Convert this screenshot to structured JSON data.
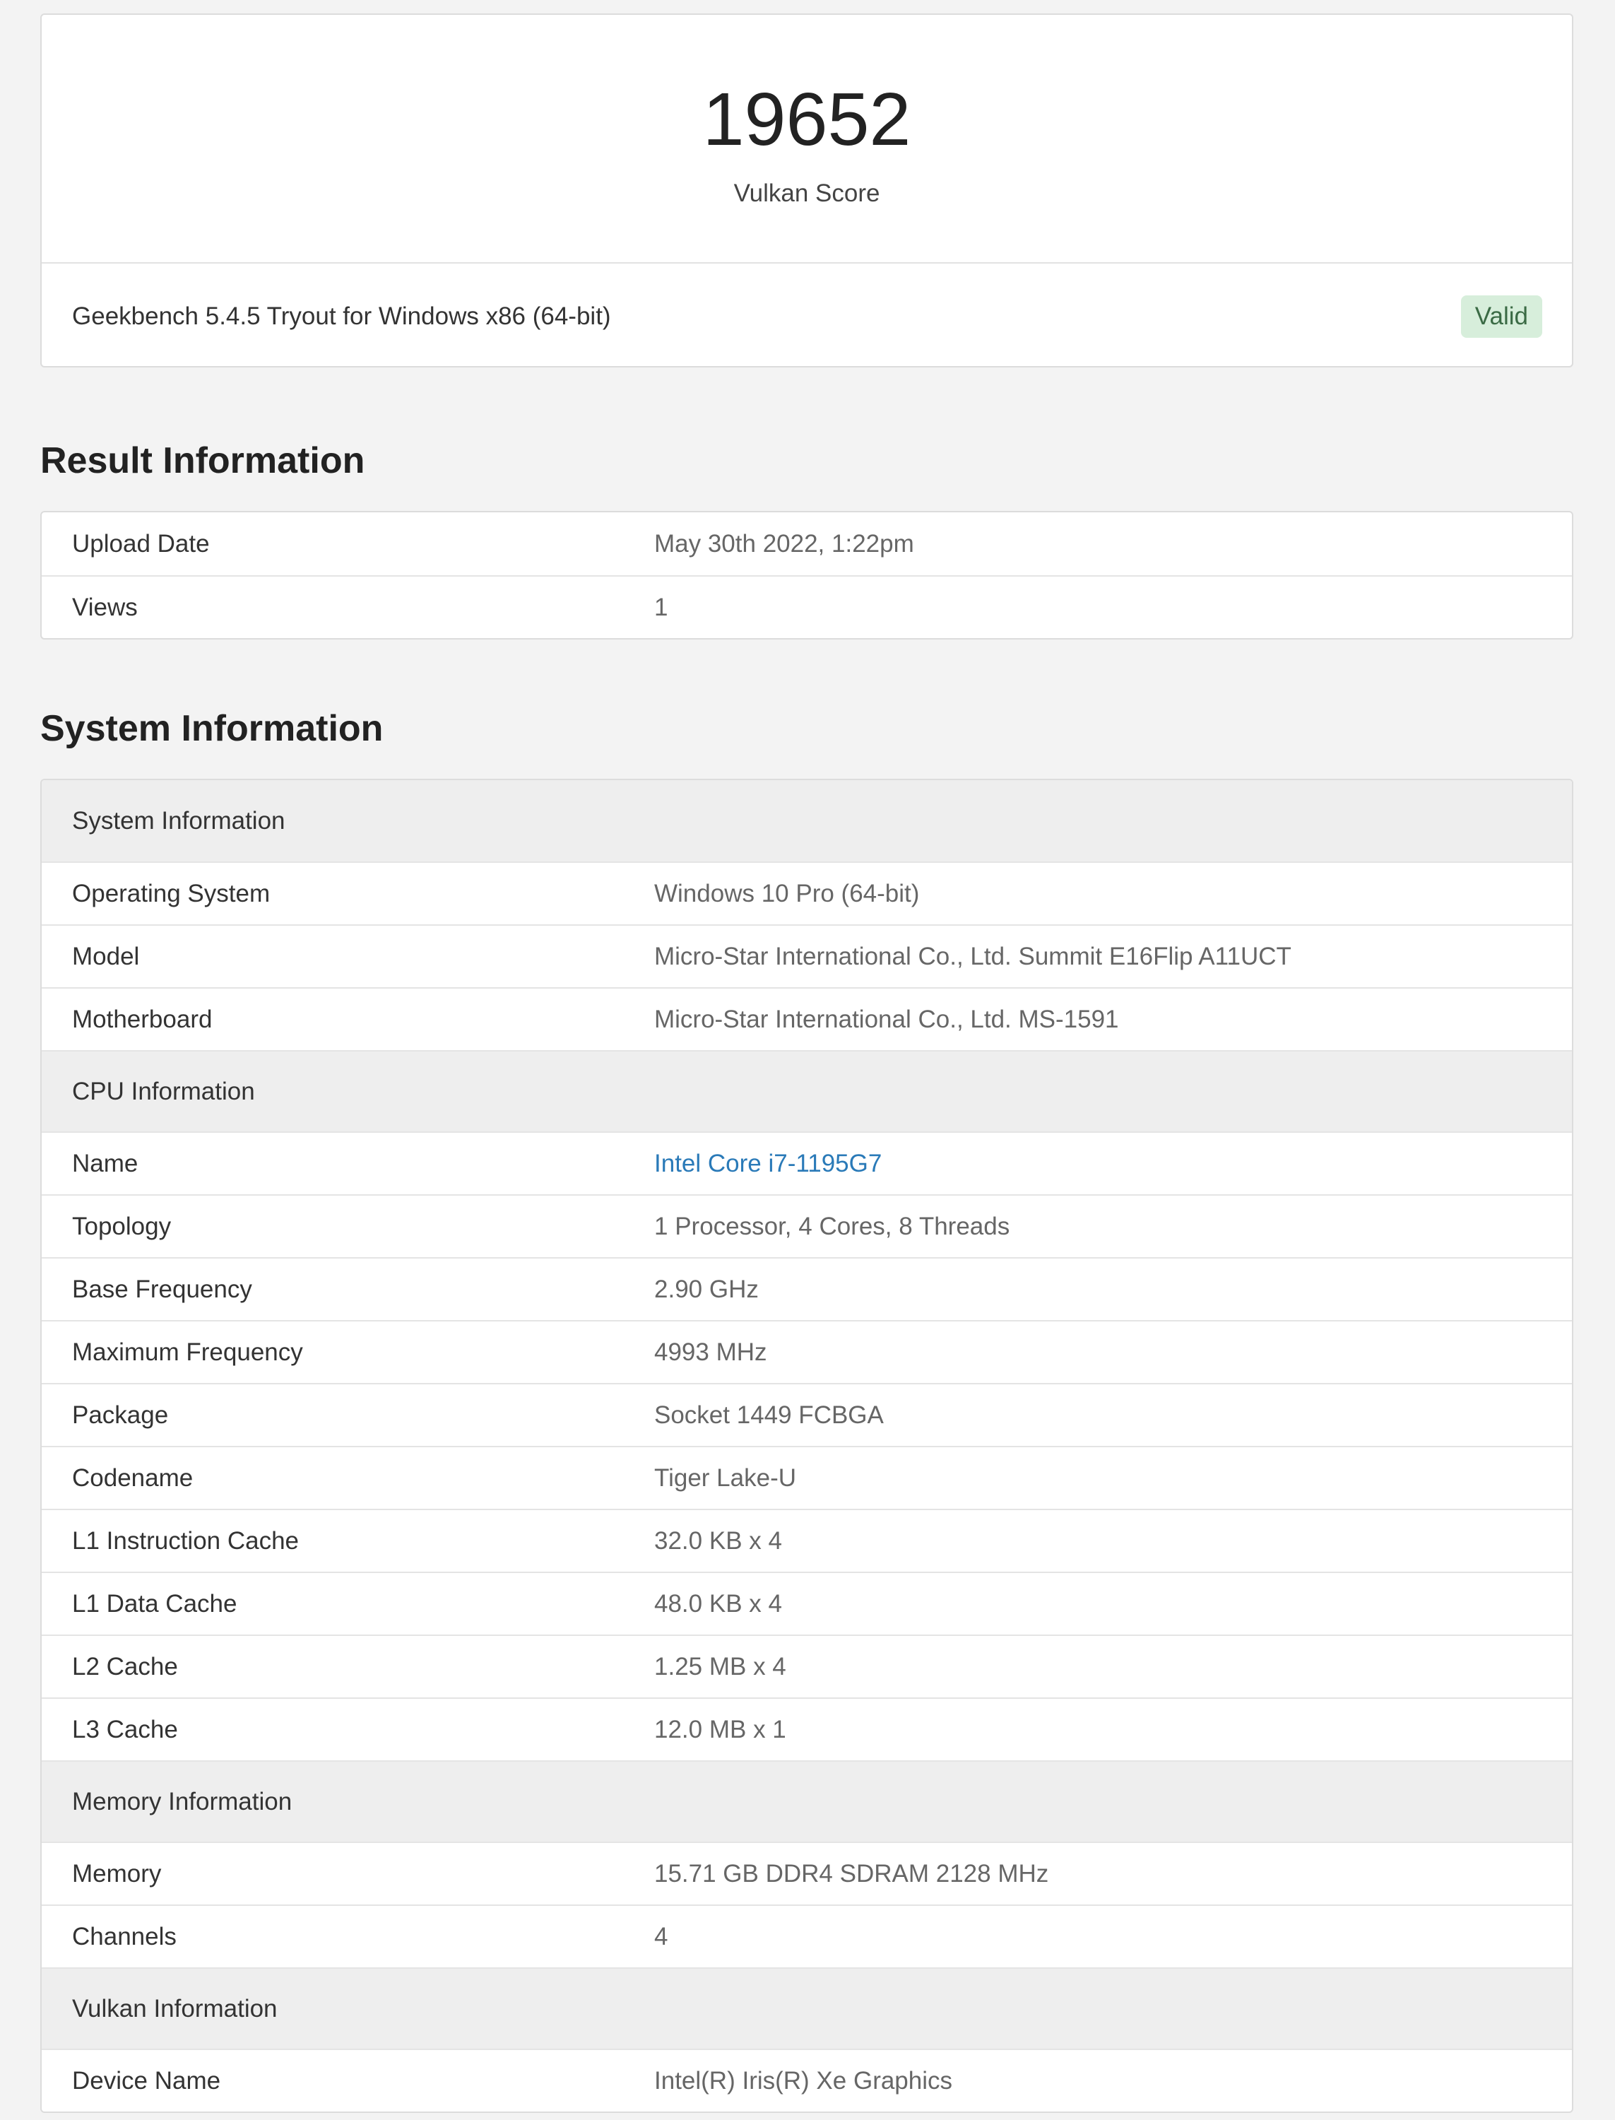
{
  "score": {
    "value": "19652",
    "label": "Vulkan Score",
    "version": "Geekbench 5.4.5 Tryout for Windows x86 (64-bit)",
    "badge": "Valid"
  },
  "result_information": {
    "title": "Result Information",
    "rows": [
      {
        "key": "Upload Date",
        "value": "May 30th 2022, 1:22pm"
      },
      {
        "key": "Views",
        "value": "1"
      }
    ]
  },
  "system_information": {
    "title": "System Information",
    "groups": [
      {
        "title": "System Information",
        "rows": [
          {
            "key": "Operating System",
            "value": "Windows 10 Pro (64-bit)"
          },
          {
            "key": "Model",
            "value": "Micro-Star International Co., Ltd. Summit E16Flip A11UCT"
          },
          {
            "key": "Motherboard",
            "value": "Micro-Star International Co., Ltd. MS-1591"
          }
        ]
      },
      {
        "title": "CPU Information",
        "rows": [
          {
            "key": "Name",
            "value": "Intel Core i7-1195G7"
          },
          {
            "key": "Topology",
            "value": "1 Processor, 4 Cores, 8 Threads"
          },
          {
            "key": "Base Frequency",
            "value": "2.90 GHz"
          },
          {
            "key": "Maximum Frequency",
            "value": "4993 MHz"
          },
          {
            "key": "Package",
            "value": "Socket 1449 FCBGA"
          },
          {
            "key": "Codename",
            "value": "Tiger Lake-U"
          },
          {
            "key": "L1 Instruction Cache",
            "value": "32.0 KB x 4"
          },
          {
            "key": "L1 Data Cache",
            "value": "48.0 KB x 4"
          },
          {
            "key": "L2 Cache",
            "value": "1.25 MB x 4"
          },
          {
            "key": "L3 Cache",
            "value": "12.0 MB x 1"
          }
        ]
      },
      {
        "title": "Memory Information",
        "rows": [
          {
            "key": "Memory",
            "value": "15.71 GB DDR4 SDRAM 2128 MHz"
          },
          {
            "key": "Channels",
            "value": "4"
          }
        ]
      },
      {
        "title": "Vulkan Information",
        "rows": [
          {
            "key": "Device Name",
            "value": "Intel(R) Iris(R) Xe Graphics"
          }
        ]
      }
    ]
  }
}
